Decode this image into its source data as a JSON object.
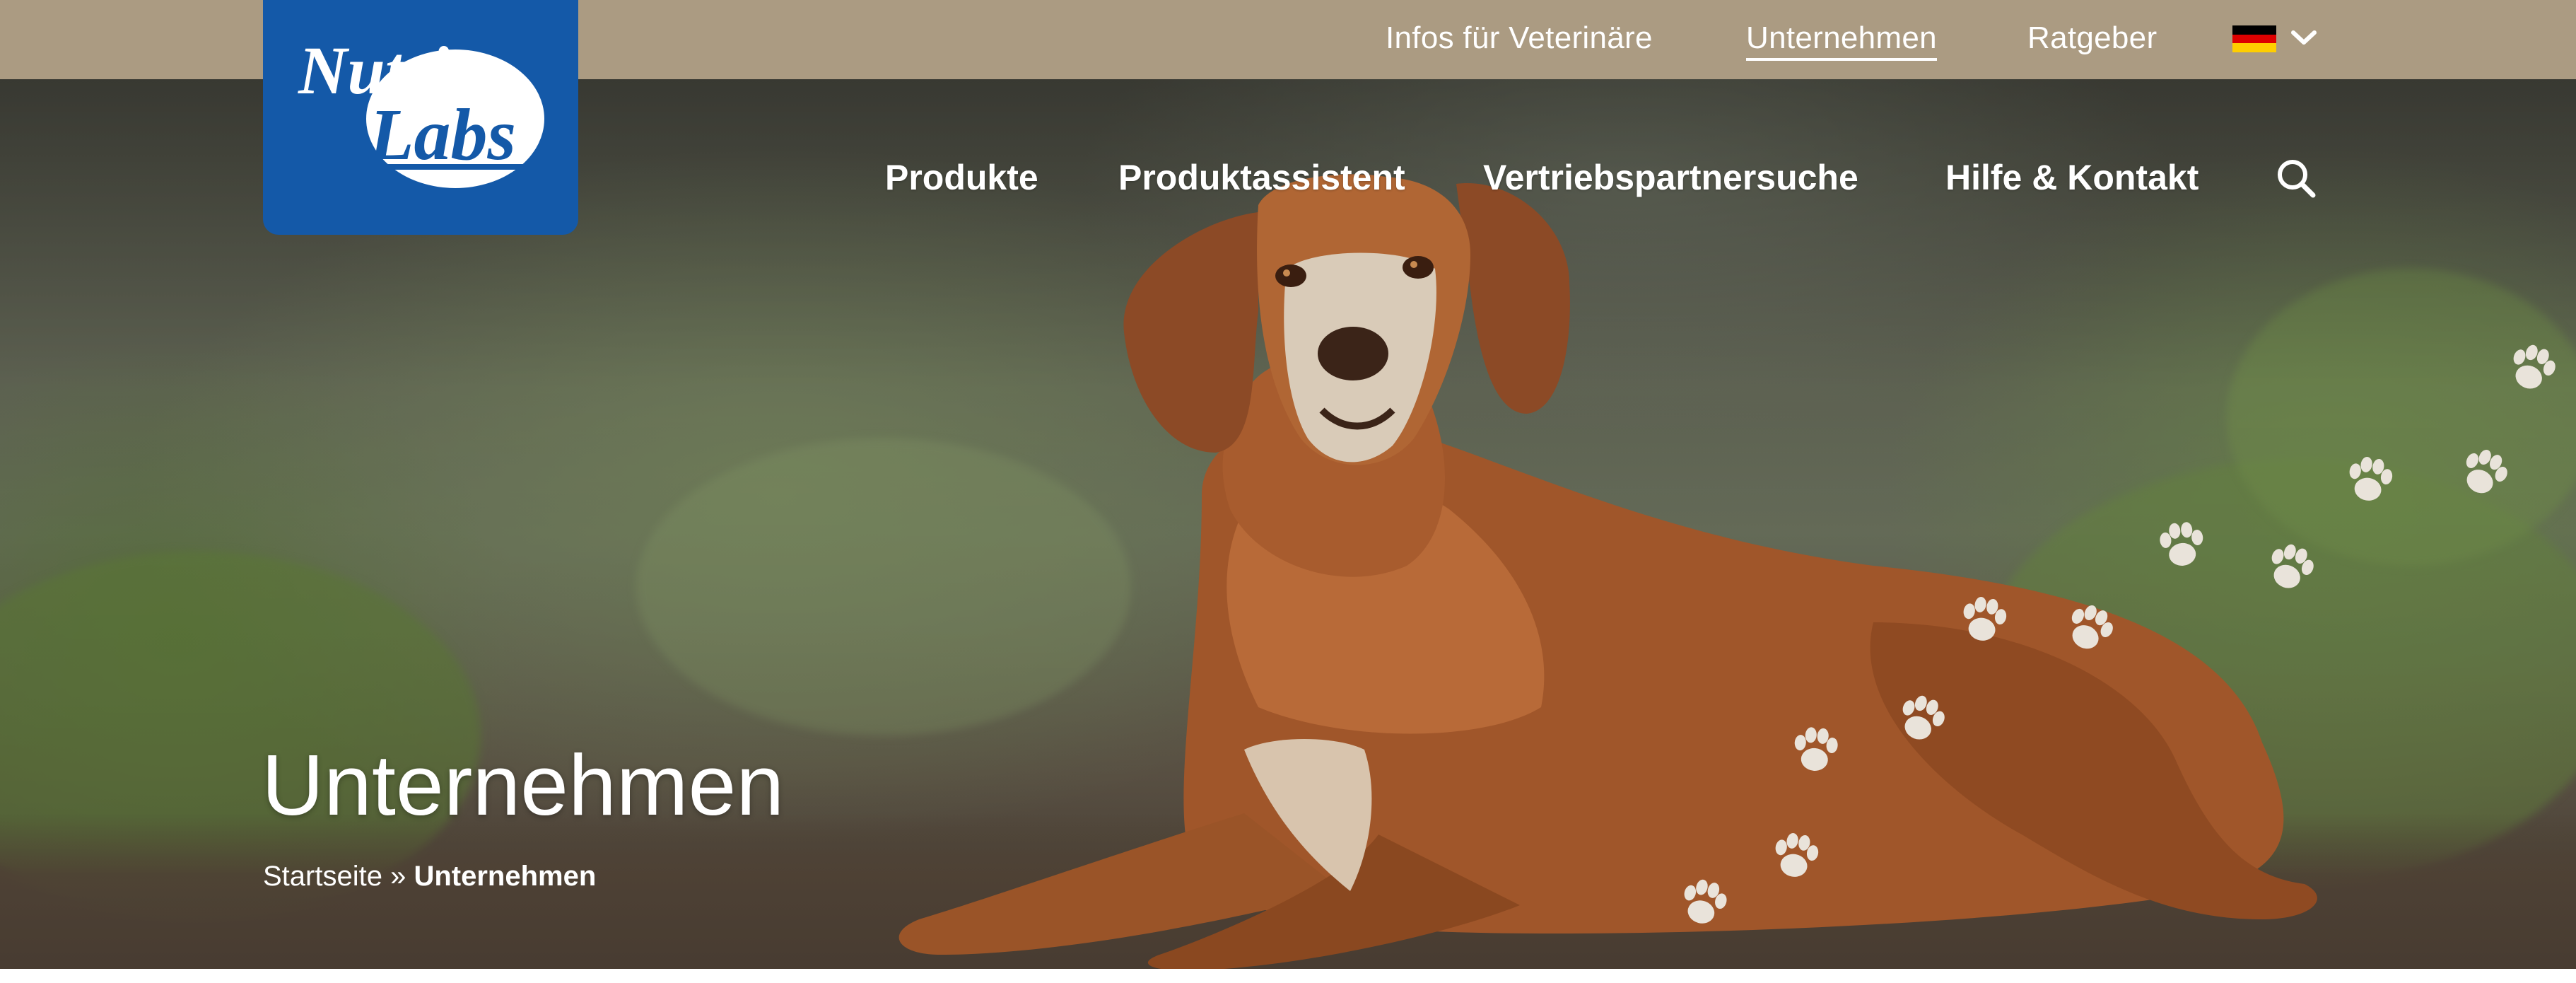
{
  "topbar": {
    "links": [
      {
        "label": "Infos für Veterinäre"
      },
      {
        "label": "Unternehmen",
        "active": true
      },
      {
        "label": "Ratgeber"
      }
    ],
    "language": {
      "flag": "de-flag-icon",
      "chevron": "chevron-down-icon"
    }
  },
  "logo": {
    "line1": "Nutri",
    "line2": "Labs"
  },
  "nav": {
    "items": [
      {
        "label": "Produkte"
      },
      {
        "label": "Produktassistent"
      },
      {
        "label": "Vertriebspartnersuche"
      },
      {
        "label": "Hilfe & Kontakt"
      }
    ],
    "search_icon": "search-icon"
  },
  "hero": {
    "title": "Unternehmen",
    "breadcrumb": {
      "home": "Startseite",
      "separator": " » ",
      "current": "Unternehmen"
    }
  },
  "colors": {
    "topbar": "#ab9b82",
    "logo_bg": "#1459a8",
    "paw": "#e9e3da",
    "text": "#ffffff"
  }
}
